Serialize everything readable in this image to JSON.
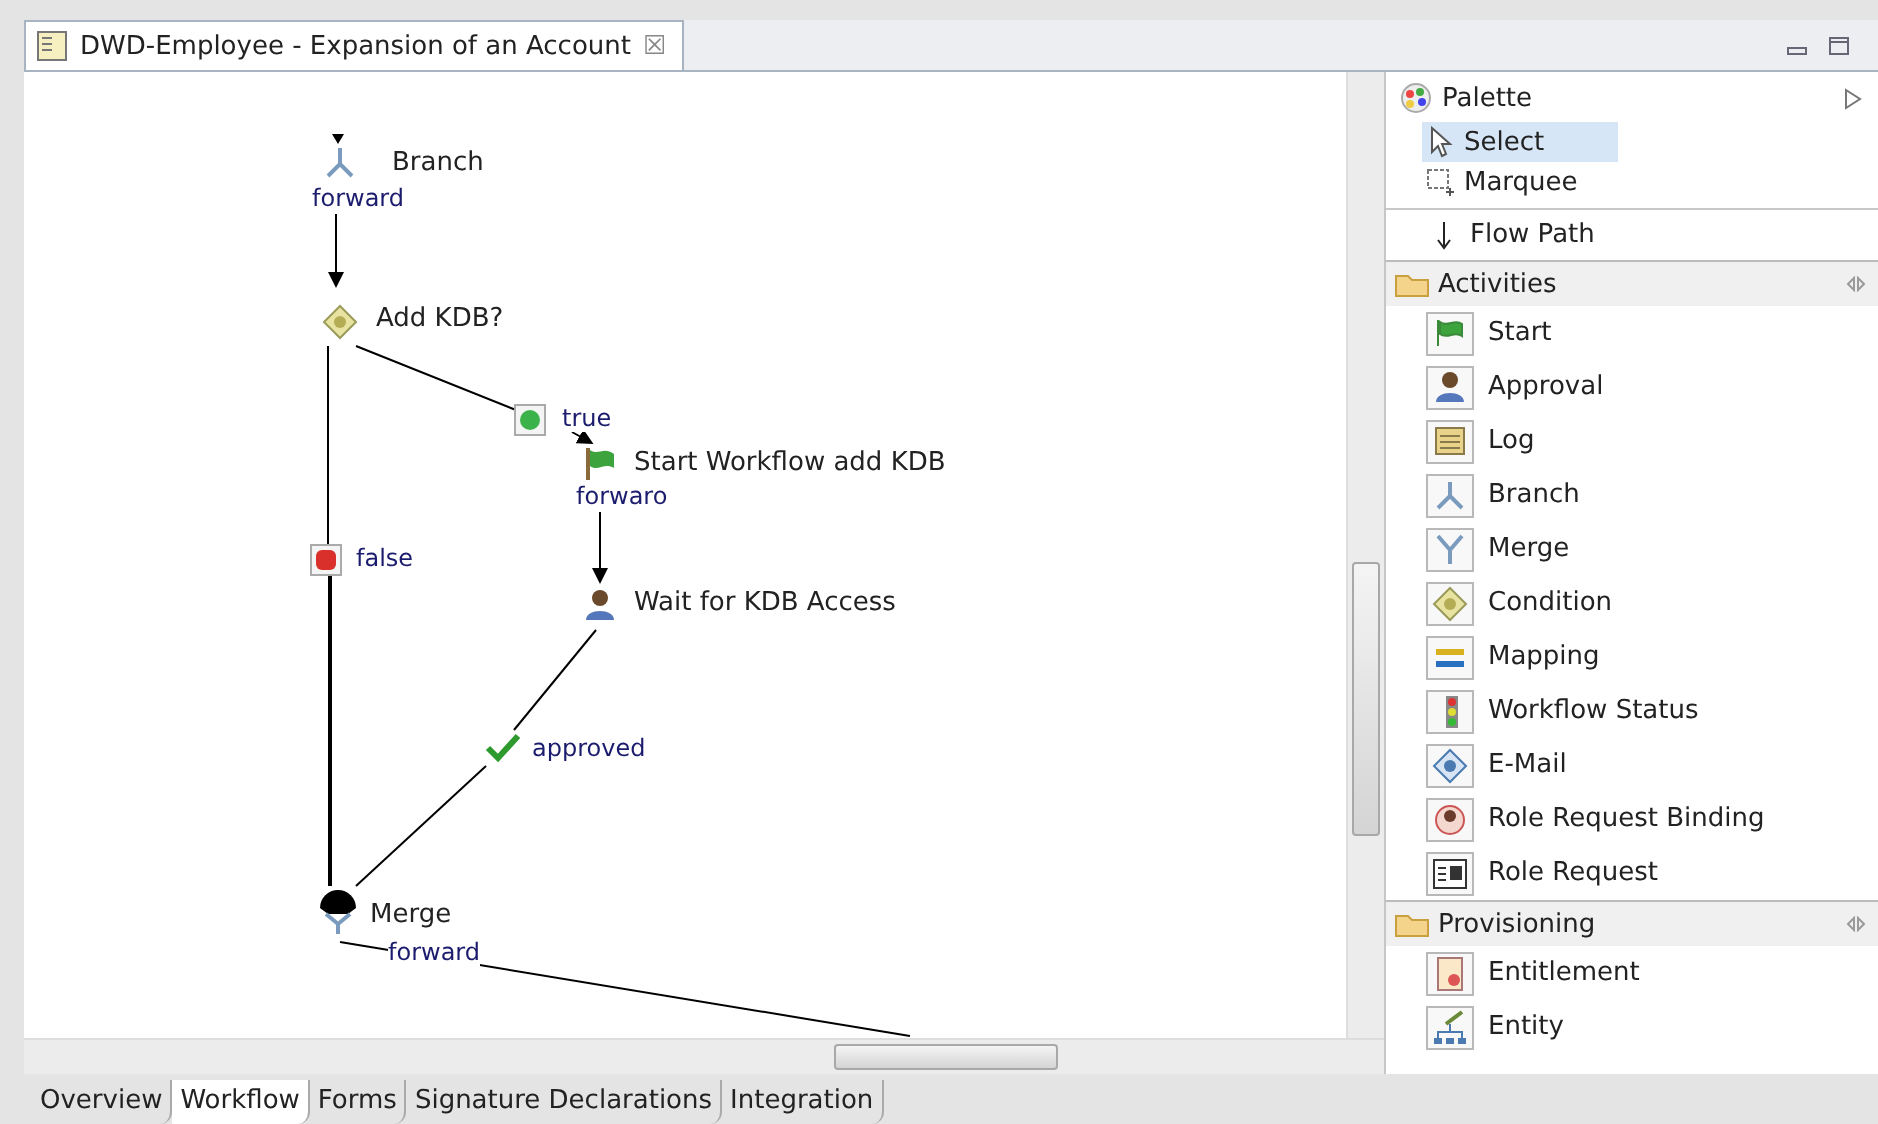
{
  "editor_tab": {
    "title": "DWD-Employee - Expansion of an Account",
    "close": "☒"
  },
  "diagram": {
    "nodes": [
      {
        "label": "Branch",
        "kind": "branch"
      },
      {
        "label": "Add KDB?",
        "kind": "condition"
      },
      {
        "label": "Start Workflow add KDB",
        "kind": "start"
      },
      {
        "label": "Wait for  KDB Access",
        "kind": "approval"
      },
      {
        "label": "Merge",
        "kind": "merge"
      }
    ],
    "edge_labels": [
      {
        "label": "forward",
        "kind": "plain"
      },
      {
        "label": "true",
        "kind": "true"
      },
      {
        "label": "forwaro",
        "kind": "plain"
      },
      {
        "label": "false",
        "kind": "false"
      },
      {
        "label": "approved",
        "kind": "approved"
      },
      {
        "label": "forward",
        "kind": "plain"
      }
    ]
  },
  "palette": {
    "title": "Palette",
    "tools": [
      {
        "label": "Select",
        "selected": true
      },
      {
        "label": "Marquee",
        "selected": false
      }
    ],
    "flow_path": "Flow Path",
    "drawers": [
      {
        "title": "Activities",
        "items": [
          "Start",
          "Approval",
          "Log",
          "Branch",
          "Merge",
          "Condition",
          "Mapping",
          "Workflow Status",
          "E-Mail",
          "Role Request Binding",
          "Role Request"
        ]
      },
      {
        "title": "Provisioning",
        "items": [
          "Entitlement",
          "Entity"
        ]
      }
    ]
  },
  "page_tabs": [
    {
      "label": "Overview",
      "selected": false
    },
    {
      "label": "Workflow",
      "selected": true
    },
    {
      "label": "Forms",
      "selected": false
    },
    {
      "label": "Signature Declarations",
      "selected": false
    },
    {
      "label": "Integration",
      "selected": false
    }
  ]
}
